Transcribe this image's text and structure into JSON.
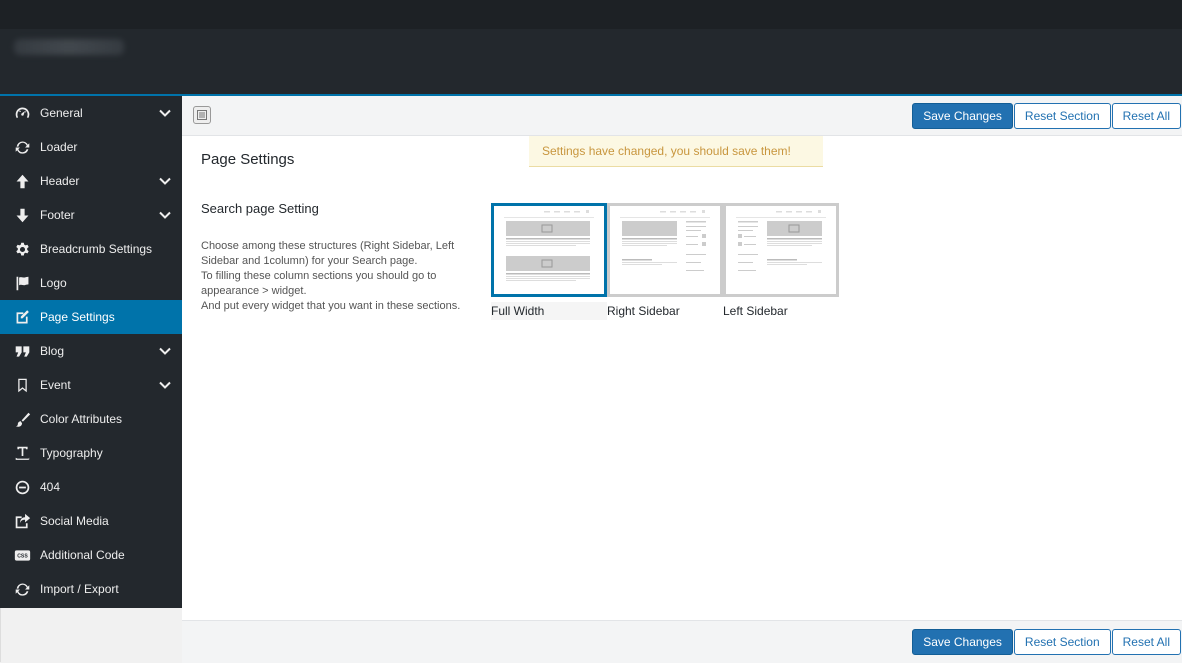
{
  "sidebar": {
    "items": [
      {
        "label": "General",
        "icon": "dashboard-icon",
        "chevron": true
      },
      {
        "label": "Loader",
        "icon": "refresh-icon",
        "chevron": false
      },
      {
        "label": "Header",
        "icon": "arrow-up-icon",
        "chevron": true
      },
      {
        "label": "Footer",
        "icon": "arrow-down-icon",
        "chevron": true
      },
      {
        "label": "Breadcrumb Settings",
        "icon": "gear-icon",
        "chevron": false
      },
      {
        "label": "Logo",
        "icon": "flag-icon",
        "chevron": false
      },
      {
        "label": "Page Settings",
        "icon": "edit-icon",
        "chevron": false,
        "active": true
      },
      {
        "label": "Blog",
        "icon": "quote-icon",
        "chevron": true
      },
      {
        "label": "Event",
        "icon": "bookmark-icon",
        "chevron": true
      },
      {
        "label": "Color Attributes",
        "icon": "brush-icon",
        "chevron": false
      },
      {
        "label": "Typography",
        "icon": "text-icon",
        "chevron": false
      },
      {
        "label": "404",
        "icon": "minus-circle-icon",
        "chevron": false
      },
      {
        "label": "Social Media",
        "icon": "share-icon",
        "chevron": false
      },
      {
        "label": "Additional Code",
        "icon": "css-icon",
        "chevron": false
      },
      {
        "label": "Import / Export",
        "icon": "refresh-icon",
        "chevron": false
      }
    ]
  },
  "toolbar": {
    "save_label": "Save Changes",
    "reset_section_label": "Reset Section",
    "reset_all_label": "Reset All"
  },
  "notice": "Settings have changed, you should save them!",
  "main": {
    "title": "Page Settings",
    "field": {
      "title": "Search page Setting",
      "description": [
        "Choose among these structures (Right Sidebar, Left Sidebar and 1column) for your Search page.",
        "To filling these column sections you should go to appearance > widget.",
        "And put every widget that you want in these sections."
      ],
      "options": [
        {
          "label": "Full Width",
          "selected": true
        },
        {
          "label": "Right Sidebar",
          "selected": false
        },
        {
          "label": "Left Sidebar",
          "selected": false
        }
      ]
    }
  },
  "colors": {
    "accent": "#0073aa",
    "button_primary": "#2271b1",
    "sidebar_bg": "#23282d",
    "notice_bg": "#fcf8e3",
    "notice_text": "#c8963e"
  }
}
